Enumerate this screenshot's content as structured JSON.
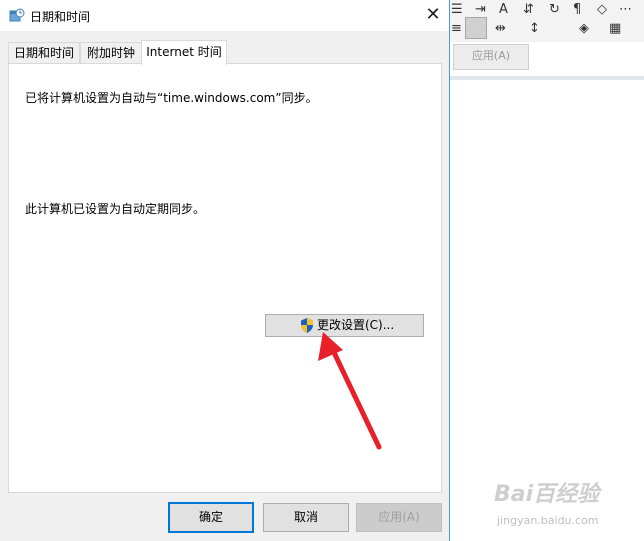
{
  "dialog": {
    "title": "日期和时间",
    "close_glyph": "✕",
    "tabs": [
      {
        "label": "日期和时间"
      },
      {
        "label": "附加时钟"
      },
      {
        "label": "Internet 时间",
        "active": true
      }
    ],
    "panel": {
      "sync_text": "已将计算机设置为自动与“time.windows.com”同步。",
      "auto_text": "此计算机已设置为自动定期同步。",
      "change_button_label": "更改设置(C)..."
    },
    "buttons": {
      "ok": "确定",
      "cancel": "取消",
      "apply": "应用(A)"
    }
  },
  "background_app": {
    "apply_label": "应用(A)"
  },
  "watermark": {
    "logo": "Bai百经验",
    "url": "jingyan.baidu.com"
  },
  "colors": {
    "accent": "#0078d7",
    "annotation_arrow": "#e8202a",
    "window_border": "#4a9bd8"
  }
}
